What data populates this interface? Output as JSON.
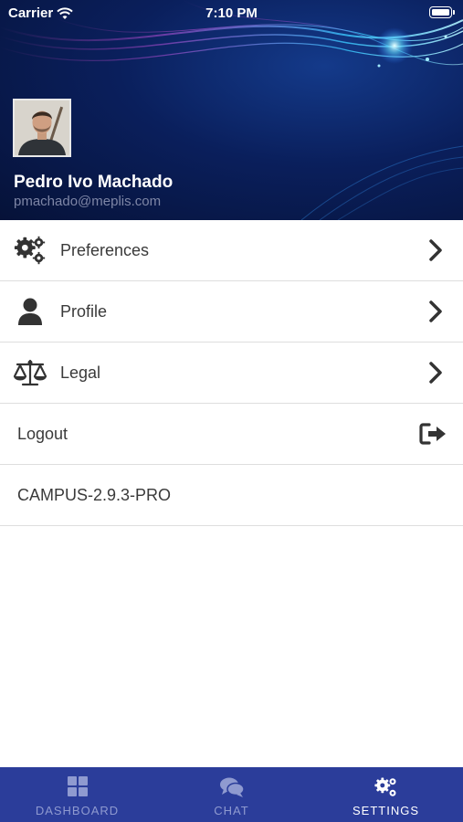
{
  "status_bar": {
    "carrier": "Carrier",
    "time": "7:10 PM"
  },
  "user": {
    "name": "Pedro Ivo Machado",
    "email": "pmachado@meplis.com"
  },
  "menu": {
    "items": [
      {
        "label": "Preferences",
        "icon": "gears-icon"
      },
      {
        "label": "Profile",
        "icon": "user-icon"
      },
      {
        "label": "Legal",
        "icon": "balance-scale-icon"
      }
    ],
    "logout_label": "Logout",
    "version": "CAMPUS-2.9.3-PRO"
  },
  "tabs": [
    {
      "label": "DASHBOARD",
      "icon": "grid-icon",
      "active": false
    },
    {
      "label": "CHAT",
      "icon": "chat-icon",
      "active": false
    },
    {
      "label": "SETTINGS",
      "icon": "gears-icon",
      "active": true
    }
  ],
  "colors": {
    "header_bg": "#0a1f5c",
    "tabbar_bg": "#2b3d9a",
    "tab_inactive": "#8f9ad0",
    "tab_active": "#ffffff",
    "email_text": "#7e86a6"
  }
}
